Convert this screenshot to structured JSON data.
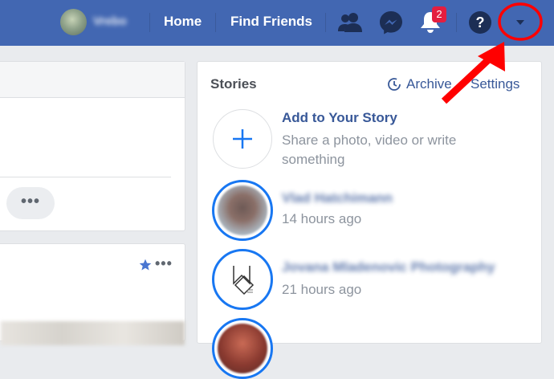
{
  "topbar": {
    "profile_name": "Vrebo",
    "home": "Home",
    "find_friends": "Find Friends",
    "notification_count": "2",
    "help_label": "?",
    "background_color": "#4267b2"
  },
  "feed": {
    "more_label": "•••",
    "post_more_label": "•••"
  },
  "stories": {
    "title": "Stories",
    "archive": "Archive",
    "settings": "Settings",
    "add_title": "Add to Your Story",
    "add_subtitle": "Share a photo, video or write something",
    "items": [
      {
        "name": "Vlad Hatchimann",
        "time": "14 hours ago"
      },
      {
        "name": "Jovana Mladenovic Photography",
        "time": "21 hours ago"
      },
      {
        "name": "",
        "time": ""
      }
    ]
  },
  "icons": [
    "friends-icon",
    "messenger-icon",
    "notifications-icon",
    "help-icon",
    "account-menu-icon",
    "archive-clock-icon",
    "plus-icon",
    "star-icon"
  ],
  "colors": {
    "accent": "#1877f2",
    "link": "#385898",
    "annotation": "#ff0000"
  }
}
